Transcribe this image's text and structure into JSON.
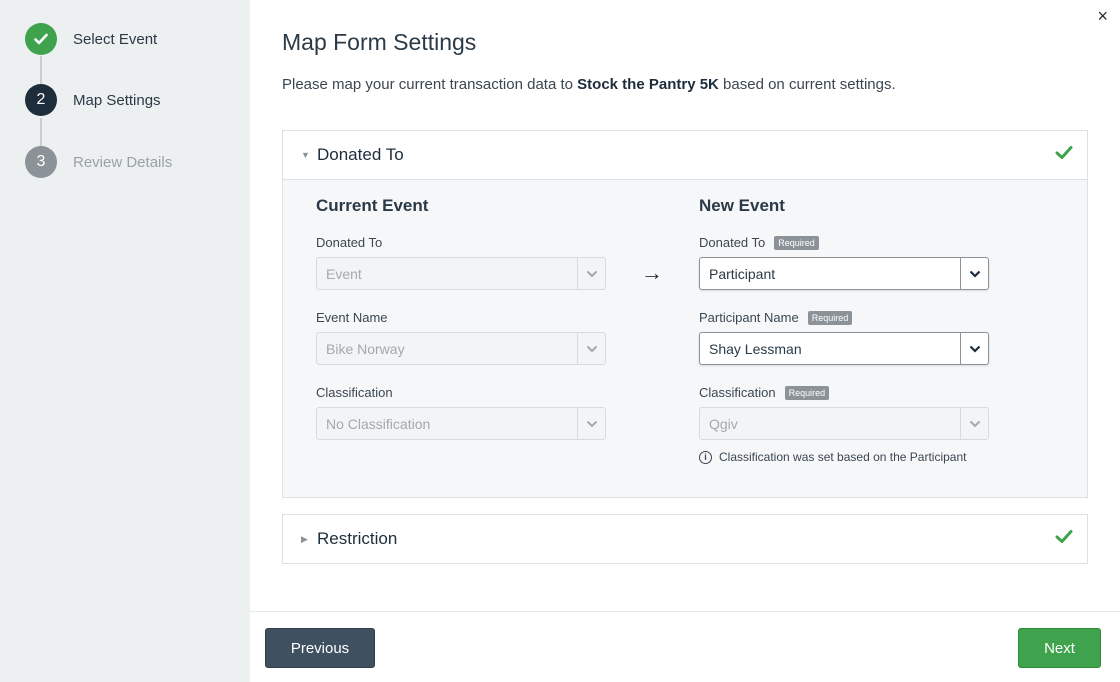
{
  "stepper": {
    "steps": [
      {
        "number": "1",
        "label": "Select Event",
        "state": "done"
      },
      {
        "number": "2",
        "label": "Map Settings",
        "state": "active"
      },
      {
        "number": "3",
        "label": "Review Details",
        "state": "pending"
      }
    ]
  },
  "header": {
    "title": "Map Form Settings",
    "subtitle_prefix": "Please map your current transaction data to ",
    "subtitle_event": "Stock the Pantry 5K",
    "subtitle_suffix": " based on current settings.",
    "close_symbol": "×"
  },
  "donated_panel": {
    "title": "Donated To",
    "current": {
      "heading": "Current Event",
      "fields": [
        {
          "label": "Donated To",
          "value": "Event"
        },
        {
          "label": "Event Name",
          "value": "Bike Norway"
        },
        {
          "label": "Classification",
          "value": "No Classification"
        }
      ]
    },
    "new": {
      "heading": "New Event",
      "required_badge": "Required",
      "fields": [
        {
          "label": "Donated To",
          "value": "Participant"
        },
        {
          "label": "Participant Name",
          "value": "Shay Lessman"
        },
        {
          "label": "Classification",
          "value": "Qgiv"
        }
      ],
      "info_text": "Classification was set based on the Participant"
    },
    "arrow": "→"
  },
  "restriction_panel": {
    "title": "Restriction"
  },
  "footer": {
    "previous_label": "Previous",
    "next_label": "Next"
  },
  "colors": {
    "success": "#3fa34d",
    "dark": "#1e2d3b",
    "muted": "#8b9298"
  }
}
